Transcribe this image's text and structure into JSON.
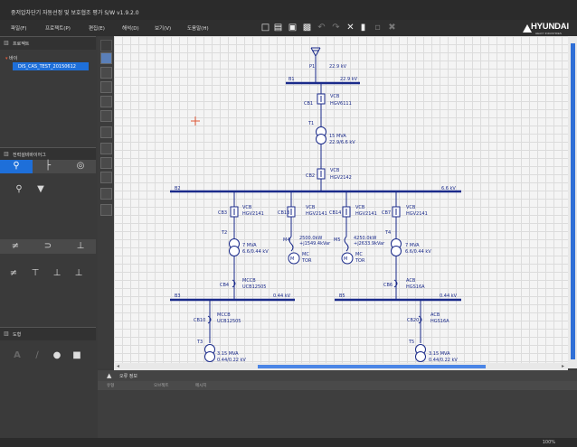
{
  "window": {
    "title": "중저압차단기 자동선정 및 보호협조 평가 S/W v1.9.2.0"
  },
  "menu": [
    "파일(F)",
    "프로젝트(P)",
    "편집(E)",
    "해석(D)",
    "보기(V)",
    "도움말(H)"
  ],
  "brand": {
    "logo": "HYUNDAI",
    "sub": "HEAVY INDUSTRIES"
  },
  "project_panel": {
    "title": "프로젝트",
    "root": "바이",
    "selected_item": "DIS_CAS_TEST_20150612"
  },
  "palette_panel": {
    "title": "전력설비바이어그"
  },
  "shape_panel": {
    "title": "도형"
  },
  "error_panel": {
    "title": "오류 정보",
    "columns": [
      "유형",
      "오브젝트",
      "메시지"
    ]
  },
  "status": {
    "zoom": "100%"
  },
  "colors": {
    "wire": "#1a2a8a",
    "bus": "#1a2a8a",
    "selected": "#1e6fd9",
    "cursor": "#e05a3a"
  },
  "diagram": {
    "source": {
      "name": "P1",
      "voltage": "22.9 kV"
    },
    "bus_b1": {
      "name": "B1",
      "voltage": "22.9 kV"
    },
    "cb1": {
      "name": "CB1",
      "type": "VCB",
      "model": "HGV6111"
    },
    "t1": {
      "name": "T1",
      "rating": "15 MVA",
      "ratio": "22.9/6.6 kV"
    },
    "cb2": {
      "name": "CB2",
      "type": "VCB",
      "model": "HGV2142"
    },
    "bus_b2": {
      "name": "B2",
      "voltage": "6.6 kV"
    },
    "cb3": {
      "name": "CB3",
      "type": "VCB",
      "model": "HGV2141"
    },
    "cb13": {
      "name": "CB13",
      "type": "VCB",
      "model": "HGV2141"
    },
    "cb14": {
      "name": "CB14",
      "type": "VCB",
      "model": "HGV2141"
    },
    "cb7": {
      "name": "CB7",
      "type": "VCB",
      "model": "HGV2141"
    },
    "t2": {
      "name": "T2",
      "rating": "7 MVA",
      "ratio": "6.6/0.44 kV"
    },
    "t4": {
      "name": "T4",
      "rating": "7 MVA",
      "ratio": "6.6/0.44 kV"
    },
    "m4": {
      "name": "M4",
      "p": "2500.0kW",
      "q": "+j1549.4kVar",
      "type": "MC",
      "kind": "TOR"
    },
    "m5": {
      "name": "M5",
      "p": "4250.0kW",
      "q": "+j2633.9kVar",
      "type": "MC",
      "kind": "TOR"
    },
    "cb4": {
      "name": "CB4",
      "type": "MCCB",
      "model": "UCB12505"
    },
    "cb6": {
      "name": "CB6",
      "type": "ACB",
      "model": "HGS16A"
    },
    "bus_b3": {
      "name": "B3",
      "voltage": "0.44 kV"
    },
    "bus_b5": {
      "name": "B5",
      "voltage": "0.44 kV"
    },
    "cb10": {
      "name": "CB10",
      "type": "MCCB",
      "model": "UCB12505"
    },
    "cb20": {
      "name": "CB20",
      "type": "ACB",
      "model": "HGS16A"
    },
    "t3": {
      "name": "T3",
      "rating": "3.15 MVA",
      "ratio": "0.44/0.22 kV"
    },
    "t5": {
      "name": "T5",
      "rating": "3.15 MVA",
      "ratio": "0.44/0.22 kV"
    },
    "motor_symbol": "M"
  }
}
